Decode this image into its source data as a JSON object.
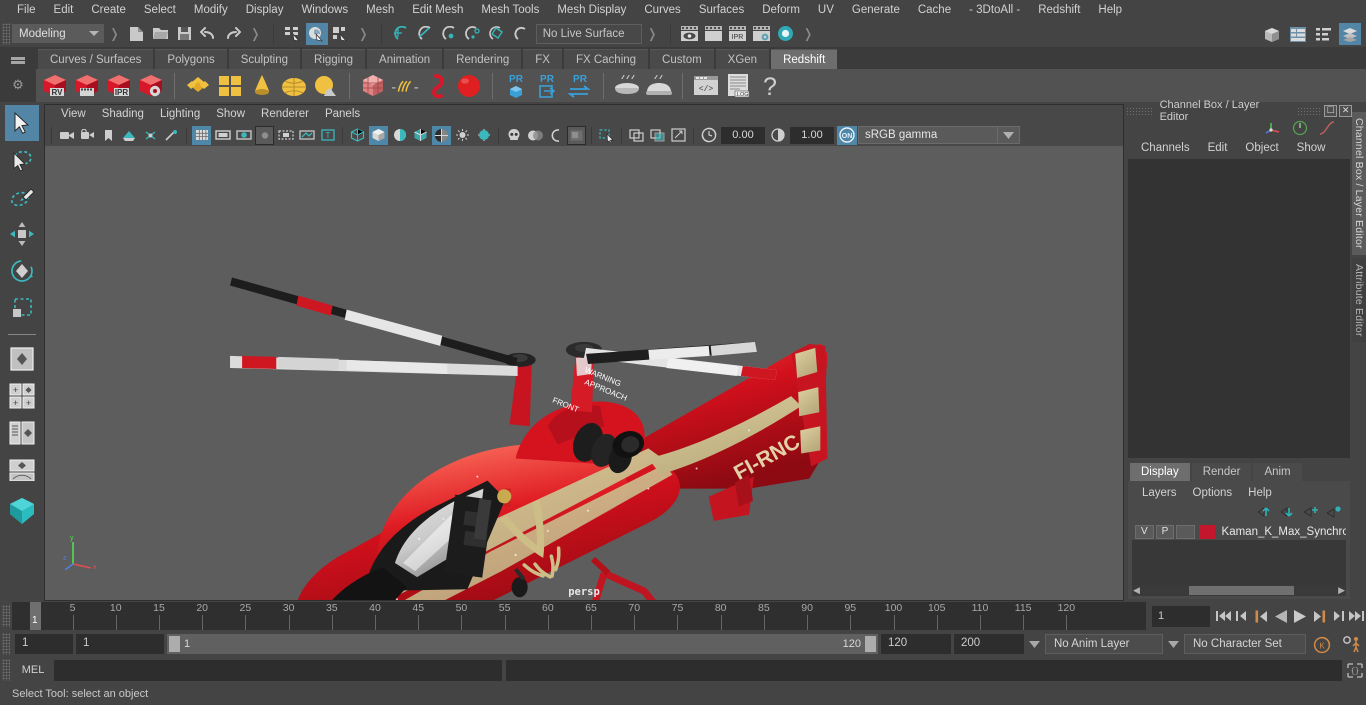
{
  "menubar": {
    "items": [
      "File",
      "Edit",
      "Create",
      "Select",
      "Modify",
      "Display",
      "Windows",
      "Mesh",
      "Edit Mesh",
      "Mesh Tools",
      "Mesh Display",
      "Curves",
      "Surfaces",
      "Deform",
      "UV",
      "Generate",
      "Cache",
      "- 3DtoAll -",
      "Redshift",
      "Help"
    ]
  },
  "statusline": {
    "mode": "Modeling",
    "live_surface": "No Live Surface",
    "icons": [
      "new-scene-icon",
      "open-scene-icon",
      "save-scene-icon",
      "undo-icon",
      "redo-icon",
      "select-by-hierarchy-icon",
      "select-by-object-icon",
      "select-by-component-icon",
      "snap-to-grid-icon",
      "snap-to-curve-icon",
      "snap-to-point-icon",
      "snap-to-projected-center-icon",
      "snap-to-view-plane-icon",
      "make-live-icon",
      "render-view-icon",
      "render-current-frame-icon",
      "ipr-render-icon",
      "render-settings-icon",
      "toggle-icon"
    ]
  },
  "shelf": {
    "tabs": [
      "Curves / Surfaces",
      "Polygons",
      "Sculpting",
      "Rigging",
      "Animation",
      "Rendering",
      "FX",
      "FX Caching",
      "Custom",
      "XGen",
      "Redshift"
    ],
    "active_tab": "Redshift",
    "icons": [
      {
        "name": "redshift-render-view",
        "label": "RV"
      },
      {
        "name": "redshift-render-sequence",
        "label": ""
      },
      {
        "name": "redshift-ipr",
        "label": "IPR"
      },
      {
        "name": "redshift-render-settings",
        "label": ""
      },
      {
        "name": "redshift-material",
        "label": ""
      },
      {
        "name": "redshift-material-blender",
        "label": ""
      },
      {
        "name": "redshift-light-cone",
        "label": ""
      },
      {
        "name": "redshift-dome-light",
        "label": ""
      },
      {
        "name": "redshift-physical-sun",
        "label": ""
      },
      {
        "name": "redshift-proxy",
        "label": ""
      },
      {
        "name": "redshift-hair",
        "label": ""
      },
      {
        "name": "redshift-volume",
        "label": ""
      },
      {
        "name": "redshift-sphere",
        "label": ""
      },
      {
        "name": "redshift-pr-object",
        "label": "PR"
      },
      {
        "name": "redshift-pr-export",
        "label": "PR"
      },
      {
        "name": "redshift-pr-swap",
        "label": "PR"
      },
      {
        "name": "redshift-bake-1",
        "label": ""
      },
      {
        "name": "redshift-bake-2",
        "label": ""
      },
      {
        "name": "redshift-script-editor",
        "label": ""
      },
      {
        "name": "redshift-log",
        "label": ".LOG"
      },
      {
        "name": "redshift-help",
        "label": "?"
      }
    ]
  },
  "toolbox": {
    "items": [
      {
        "name": "select-tool",
        "selected": true
      },
      {
        "name": "lasso-select-tool",
        "selected": false
      },
      {
        "name": "paint-select-tool",
        "selected": false
      },
      {
        "name": "move-tool",
        "selected": false
      },
      {
        "name": "rotate-tool",
        "selected": false
      },
      {
        "name": "scale-tool",
        "selected": false
      },
      {
        "name": "single-perspective-layout",
        "selected": false
      },
      {
        "name": "four-view-layout",
        "selected": false
      },
      {
        "name": "outliner-persp-layout",
        "selected": false
      },
      {
        "name": "persp-graph-layout",
        "selected": false
      },
      {
        "name": "maya-logo",
        "selected": false
      }
    ]
  },
  "viewport": {
    "menus": [
      "View",
      "Shading",
      "Lighting",
      "Show",
      "Renderer",
      "Panels"
    ],
    "camera_label": "persp",
    "exposure": "0.00",
    "gamma": "1.00",
    "color_management": "sRGB gamma",
    "toolbar_icons": [
      "camera-icon",
      "camera-attributes-icon",
      "bookmark-icon",
      "image-plane-icon",
      "two-sided-lighting-icon",
      "shadows-icon",
      "grid-icon",
      "film-gate-icon",
      "resolution-gate-icon",
      "gate-mask-icon",
      "film-origin-icon",
      "xray-icon",
      "texture-icon",
      "wireframe-icon",
      "smooth-shade-icon",
      "flat-shade-icon",
      "shaded-wireframe-icon",
      "textured-icon",
      "lights-icon",
      "default-light-icon",
      "all-lights-icon",
      "skull-icon",
      "xray-joints-icon",
      "xray-active-icon",
      "occlusion-icon",
      "isolate-select-icon",
      "view-transform-icon",
      "color-management-icon",
      "exposure-icon",
      "gamma-icon"
    ]
  },
  "right_panel": {
    "title": "Channel Box / Layer Editor",
    "menus": [
      "Channels",
      "Edit",
      "Object",
      "Show"
    ],
    "layer_tabs": [
      "Display",
      "Render",
      "Anim"
    ],
    "active_layer_tab": "Display",
    "layer_menus": [
      "Layers",
      "Options",
      "Help"
    ],
    "layer_buttons": [
      "move-layer-up-icon",
      "move-layer-down-icon",
      "new-layer-icon",
      "new-layer-from-selected-icon"
    ],
    "layers": [
      {
        "visibility": "V",
        "playback": "P",
        "shading": "",
        "color": "#c4162c",
        "name": "Kaman_K_Max_Synchro"
      }
    ],
    "side_tabs": [
      "Channel Box / Layer Editor",
      "Attribute Editor"
    ]
  },
  "timeline": {
    "ticks": [
      5,
      10,
      15,
      20,
      25,
      30,
      35,
      40,
      45,
      50,
      55,
      60,
      65,
      70,
      75,
      80,
      85,
      90,
      95,
      100,
      105,
      110,
      115,
      120
    ],
    "current_frame": "1",
    "current_frame_field": "1",
    "playback_buttons": [
      "go-to-start-icon",
      "step-back-frame-icon",
      "previous-key-icon",
      "play-backwards-icon",
      "play-forwards-icon",
      "next-key-icon",
      "step-forward-frame-icon",
      "go-to-end-icon"
    ]
  },
  "range": {
    "anim_start": "1",
    "range_start": "1",
    "slider_start_label": "1",
    "slider_end_label": "120",
    "range_end": "120",
    "anim_end": "200",
    "anim_layer": "No Anim Layer",
    "character_set": "No Character Set",
    "right_icons": [
      "auto-key-icon",
      "animation-preferences-icon"
    ]
  },
  "command": {
    "language": "MEL",
    "input_value": "",
    "output_value": "",
    "script-editor-icon": "script-editor-icon"
  },
  "helpline": {
    "text": "Select Tool: select an object"
  },
  "window_right_icons": [
    "modeling-toolkit-icon",
    "attribute-editor-icon",
    "channel-box-icon",
    "layer-editor-icon"
  ],
  "colors": {
    "accent_blue": "#5285a6",
    "accent_teal": "#2fb0b5",
    "layer_red": "#c4162c",
    "orange": "#d6894a",
    "viewport_bg": "#5d5d5d"
  }
}
